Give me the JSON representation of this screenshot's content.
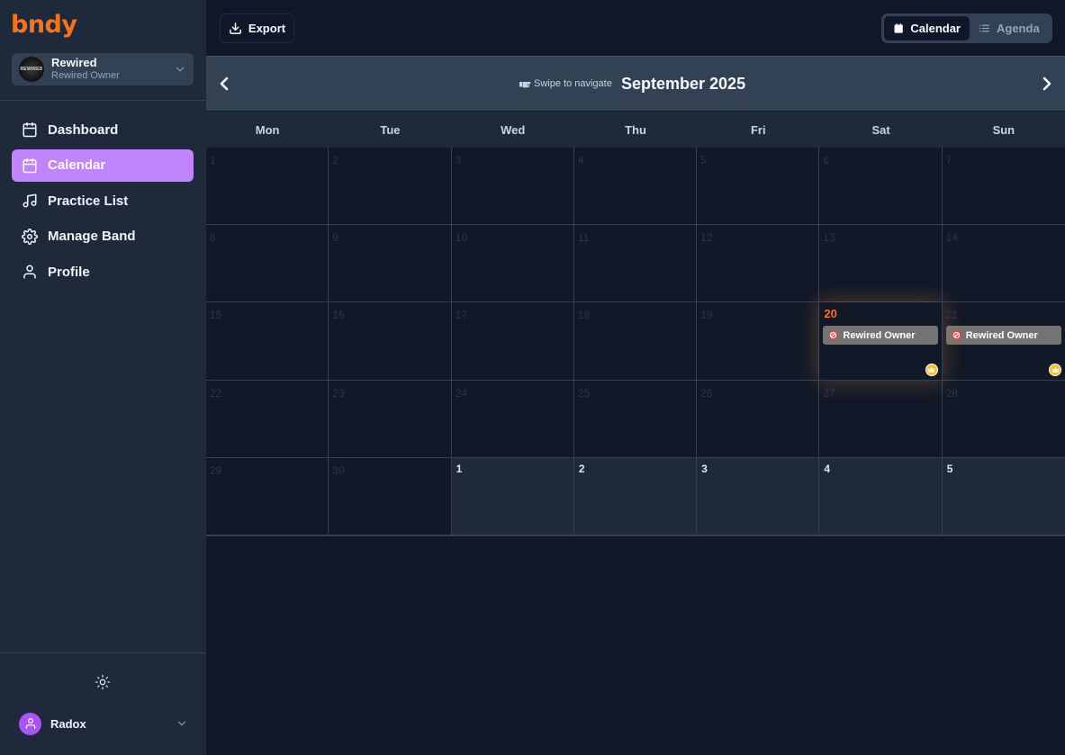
{
  "app": {
    "logo": "bndy"
  },
  "band": {
    "name": "Rewired",
    "role": "Rewired Owner",
    "avatar_text": "REWIRED"
  },
  "nav": [
    {
      "label": "Dashboard",
      "icon": "calendar-icon",
      "active": false
    },
    {
      "label": "Calendar",
      "icon": "calendar-icon",
      "active": true
    },
    {
      "label": "Practice List",
      "icon": "music-note-icon",
      "active": false
    },
    {
      "label": "Manage Band",
      "icon": "gear-icon",
      "active": false
    },
    {
      "label": "Profile",
      "icon": "user-icon",
      "active": false
    }
  ],
  "user": {
    "name": "Radox"
  },
  "toolbar": {
    "export_label": "Export"
  },
  "view_toggle": {
    "calendar_label": "Calendar",
    "agenda_label": "Agenda",
    "selected": "Calendar"
  },
  "calendar": {
    "swipe_hint": "Swipe to navigate",
    "month_title": "September 2025",
    "weekdays": [
      "Mon",
      "Tue",
      "Wed",
      "Thu",
      "Fri",
      "Sat",
      "Sun"
    ],
    "weeks": [
      [
        "1",
        "2",
        "3",
        "4",
        "5",
        "6",
        "7"
      ],
      [
        "8",
        "9",
        "10",
        "11",
        "12",
        "13",
        "14"
      ],
      [
        "15",
        "16",
        "17",
        "18",
        "19",
        "20",
        "21"
      ],
      [
        "22",
        "23",
        "24",
        "25",
        "26",
        "27",
        "28"
      ],
      [
        "29",
        "30",
        "1",
        "2",
        "3",
        "4",
        "5"
      ]
    ],
    "today": "20",
    "events": [
      {
        "day": "20",
        "title": "Rewired Owner"
      },
      {
        "day": "21",
        "title": "Rewired Owner"
      }
    ],
    "colors": {
      "accent": "#f97316",
      "active_nav": "#c084fc",
      "event": "#737373",
      "crown": "#fbbf24"
    }
  }
}
